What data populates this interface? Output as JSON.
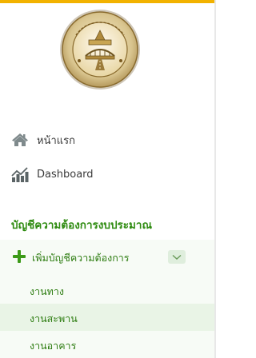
{
  "menu": {
    "home_label": "หน้าแรก",
    "dashboard_label": "Dashboard",
    "section_title": "บัญชีความต้องการงบประมาณ",
    "add_list_label": "เพิ่มบัญชีความต้องการ",
    "sub_items": [
      "งานทาง",
      "งานสะพาน",
      "งานอาคาร"
    ]
  },
  "colors": {
    "accent": "#2e8b10",
    "top_bar": "#f2b200",
    "active_row": "#e9f4e6"
  },
  "icons": {
    "home": "home-icon",
    "dashboard": "bar-chart-icon",
    "add": "plus-icon",
    "expand": "chevron-down-icon",
    "logo": "department-seal-logo"
  }
}
